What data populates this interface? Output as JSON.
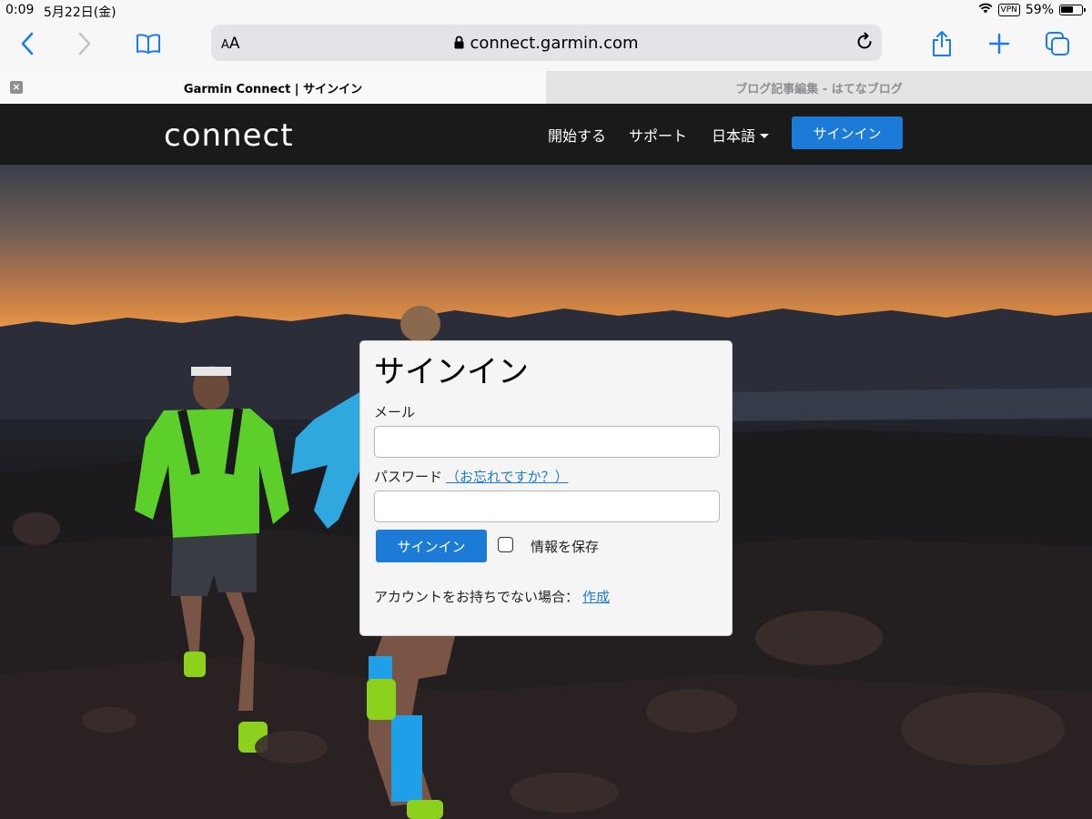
{
  "status_bar": {
    "time": "0:09",
    "date": "5月22日(金)",
    "vpn": "VPN",
    "battery": "59%"
  },
  "browser": {
    "aa_small": "A",
    "aa_large": "A",
    "url": "connect.garmin.com",
    "tabs": [
      {
        "label": "Garmin Connect | サインイン",
        "active": true
      },
      {
        "label": "ブログ記事編集 - はてなブログ",
        "active": false
      }
    ]
  },
  "site_nav": {
    "logo": "connect",
    "get_started": "開始する",
    "support": "サポート",
    "language": "日本語",
    "sign_in": "サインイン"
  },
  "signin_form": {
    "title": "サインイン",
    "email_label": "メール",
    "email_value": "",
    "password_label": "パスワード",
    "forgot_link": "（お忘れですか？）",
    "password_value": "",
    "submit_label": "サインイン",
    "remember_label": "情報を保存",
    "remember_checked": false,
    "no_account_text": "アカウントをお持ちでない場合：",
    "create_link": "作成"
  },
  "colors": {
    "accent": "#1d7bd8",
    "nav_background": "#1a1a1a"
  }
}
